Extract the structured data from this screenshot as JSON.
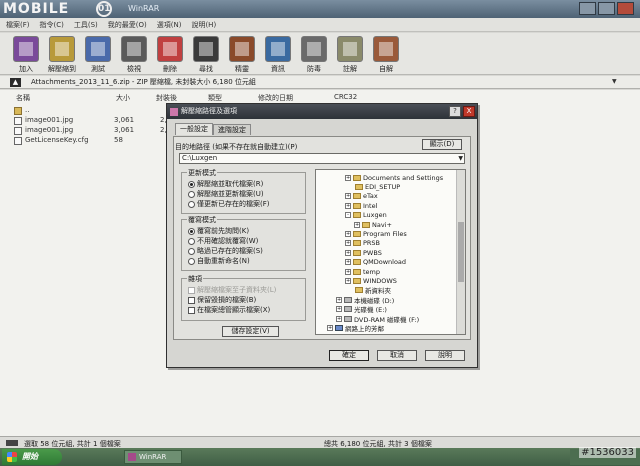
{
  "watermark": {
    "text": "MOBILE",
    "badge": "01"
  },
  "window": {
    "title": "WinRAR"
  },
  "menu": [
    "檔案(F)",
    "指令(C)",
    "工具(S)",
    "我的最愛(O)",
    "選項(N)",
    "說明(H)"
  ],
  "toolbar": [
    {
      "label": "加入",
      "icon": "add-archive-icon",
      "color": "#7a4a9a"
    },
    {
      "label": "解壓縮到",
      "icon": "extract-to-icon",
      "color": "#b89a3a"
    },
    {
      "label": "測試",
      "icon": "test-icon",
      "color": "#4a6aaa"
    },
    {
      "label": "檢視",
      "icon": "view-binoculars-icon",
      "color": "#5a5a5a"
    },
    {
      "label": "刪除",
      "icon": "delete-icon",
      "color": "#c04040"
    },
    {
      "label": "尋找",
      "icon": "find-binoculars-icon",
      "color": "#3a3a3a"
    },
    {
      "label": "精靈",
      "icon": "wizard-icon",
      "color": "#8a4a2a"
    },
    {
      "label": "資訊",
      "icon": "info-icon",
      "color": "#3a6aa0"
    },
    {
      "label": "防毒",
      "icon": "antivirus-icon",
      "color": "#6a6a6a"
    },
    {
      "label": "註解",
      "icon": "comment-icon",
      "color": "#8a8a6a"
    },
    {
      "label": "自解",
      "icon": "sfx-icon",
      "color": "#9a5a3a"
    }
  ],
  "address": {
    "text": "Attachments_2013_11_6.zip - ZIP 壓縮檔, 未封裝大小 6,180 位元組"
  },
  "filelist": {
    "headers": [
      "名稱",
      "大小",
      "封裝後",
      "類型",
      "修改的日期",
      "CRC32"
    ],
    "rows": [
      {
        "name": "..",
        "size": "",
        "packed": "",
        "type": "folder"
      },
      {
        "name": "image001.jpg",
        "size": "3,061",
        "packed": "2,",
        "type": "file"
      },
      {
        "name": "image001.jpg",
        "size": "3,061",
        "packed": "2,",
        "type": "file"
      },
      {
        "name": "GetLicenseKey.cfg",
        "size": "58",
        "packed": "",
        "type": "file"
      }
    ]
  },
  "status": {
    "left": "選取 58 位元組, 共計 1 個檔案",
    "right": "總共 6,180 位元組, 共計 3 個檔案"
  },
  "taskbar": {
    "start": "開始",
    "task": "WinRAR"
  },
  "photo_id": "#1536033",
  "dialog": {
    "title": "解壓縮路徑及選項",
    "help": "?",
    "close": "X",
    "tabs": [
      "一般設定",
      "進階設定"
    ],
    "dest_label": "目的地路徑 (如果不存在就自動建立)(P)",
    "show_button": "顯示(D)",
    "dest_value": "C:\\Luxgen",
    "update_group": {
      "title": "更新模式",
      "options": [
        "解壓縮並取代檔案(R)",
        "解壓縮並更新檔案(U)",
        "僅更新已存在的檔案(F)"
      ],
      "selected": 0
    },
    "overwrite_group": {
      "title": "覆寫模式",
      "options": [
        "覆寫前先詢問(K)",
        "不用確認就覆寫(W)",
        "略過已存在的檔案(S)",
        "自動重新命名(N)"
      ],
      "selected": 0
    },
    "misc_group": {
      "title": "雜項",
      "options": [
        "解壓縮檔案至子資料夾(L)",
        "保留毀損的檔案(B)",
        "在檔案總管顯示檔案(X)"
      ],
      "disabled": [
        true,
        false,
        false
      ]
    },
    "save_button": "儲存設定(V)",
    "tree": [
      {
        "label": "Documents and Settings",
        "indent": 1,
        "kind": "folder",
        "exp": "+"
      },
      {
        "label": "EDI_SETUP",
        "indent": 1,
        "kind": "folder",
        "exp": ""
      },
      {
        "label": "eTax",
        "indent": 1,
        "kind": "folder",
        "exp": "+"
      },
      {
        "label": "Intel",
        "indent": 1,
        "kind": "folder",
        "exp": "+"
      },
      {
        "label": "Luxgen",
        "indent": 1,
        "kind": "folder",
        "exp": "-"
      },
      {
        "label": "Navi+",
        "indent": 2,
        "kind": "folder",
        "exp": "+"
      },
      {
        "label": "Program Files",
        "indent": 1,
        "kind": "folder",
        "exp": "+"
      },
      {
        "label": "PRSB",
        "indent": 1,
        "kind": "folder",
        "exp": "+"
      },
      {
        "label": "PWBS",
        "indent": 1,
        "kind": "folder",
        "exp": "+"
      },
      {
        "label": "QMDownload",
        "indent": 1,
        "kind": "folder",
        "exp": "+"
      },
      {
        "label": "temp",
        "indent": 1,
        "kind": "folder",
        "exp": "+"
      },
      {
        "label": "WINDOWS",
        "indent": 1,
        "kind": "folder",
        "exp": "+"
      },
      {
        "label": "新資料夾",
        "indent": 1,
        "kind": "folder",
        "exp": ""
      },
      {
        "label": "本機磁碟 (D:)",
        "indent": 0,
        "kind": "drive",
        "exp": "+"
      },
      {
        "label": "光碟機 (E:)",
        "indent": 0,
        "kind": "drive",
        "exp": "+"
      },
      {
        "label": "DVD-RAM 磁碟機 (F:)",
        "indent": 0,
        "kind": "drive",
        "exp": "+"
      },
      {
        "label": "網路上的芳鄰",
        "indent": -1,
        "kind": "network",
        "exp": "+"
      }
    ],
    "ok": "確定",
    "cancel": "取消",
    "help_button": "說明"
  }
}
